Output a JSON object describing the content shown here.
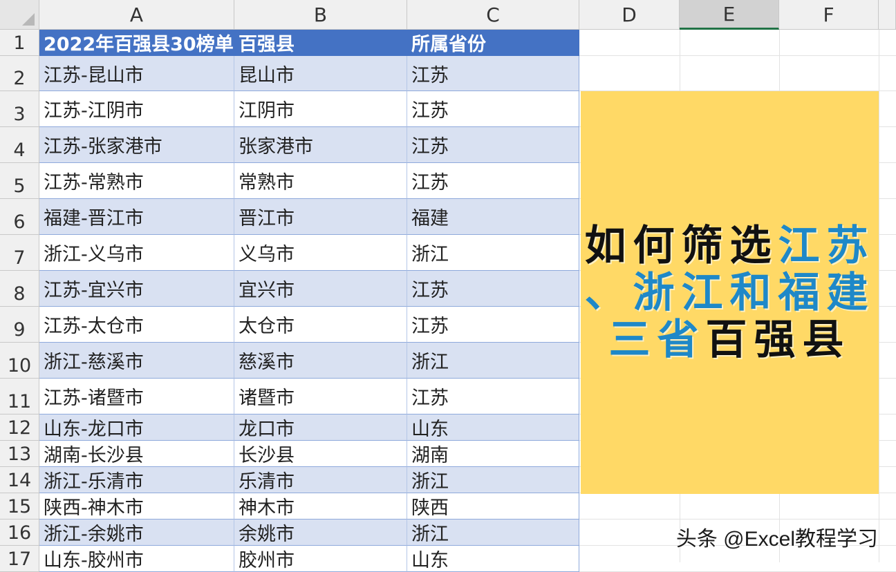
{
  "columns": [
    "A",
    "B",
    "C",
    "D",
    "E",
    "F"
  ],
  "selected_column": "E",
  "rows": [
    {
      "n": "1",
      "a": "2022年百强县30榜单",
      "b": "百强县",
      "c": "所属省份"
    },
    {
      "n": "2",
      "a": "江苏-昆山市",
      "b": "昆山市",
      "c": "江苏"
    },
    {
      "n": "3",
      "a": "江苏-江阴市",
      "b": "江阴市",
      "c": "江苏"
    },
    {
      "n": "4",
      "a": "江苏-张家港市",
      "b": "张家港市",
      "c": "江苏"
    },
    {
      "n": "5",
      "a": "江苏-常熟市",
      "b": "常熟市",
      "c": "江苏"
    },
    {
      "n": "6",
      "a": "福建-晋江市",
      "b": "晋江市",
      "c": "福建"
    },
    {
      "n": "7",
      "a": "浙江-义乌市",
      "b": "义乌市",
      "c": "浙江"
    },
    {
      "n": "8",
      "a": "江苏-宜兴市",
      "b": "宜兴市",
      "c": "江苏"
    },
    {
      "n": "9",
      "a": "江苏-太仓市",
      "b": "太仓市",
      "c": "江苏"
    },
    {
      "n": "10",
      "a": "浙江-慈溪市",
      "b": "慈溪市",
      "c": "浙江"
    },
    {
      "n": "11",
      "a": "江苏-诸暨市",
      "b": "诸暨市",
      "c": "江苏"
    },
    {
      "n": "12",
      "a": "山东-龙口市",
      "b": "龙口市",
      "c": "山东"
    },
    {
      "n": "13",
      "a": "湖南-长沙县",
      "b": "长沙县",
      "c": "湖南"
    },
    {
      "n": "14",
      "a": "浙江-乐清市",
      "b": "乐清市",
      "c": "浙江"
    },
    {
      "n": "15",
      "a": "陕西-神木市",
      "b": "神木市",
      "c": "陕西"
    },
    {
      "n": "16",
      "a": "浙江-余姚市",
      "b": "余姚市",
      "c": "浙江"
    },
    {
      "n": "17",
      "a": "山东-胶州市",
      "b": "胶州市",
      "c": "山东"
    }
  ],
  "banner": {
    "line1_dark": "如何筛选",
    "line1_blue": "江苏",
    "line2_blue": "、浙江和福建",
    "line3_blue": "三省",
    "line3_dark": "百强县"
  },
  "watermark": "头条 @Excel教程学习",
  "colors": {
    "header_fill": "#4472c4",
    "band_fill": "#d9e1f2",
    "banner_fill": "#ffd966",
    "banner_blue": "#1e88c8"
  }
}
